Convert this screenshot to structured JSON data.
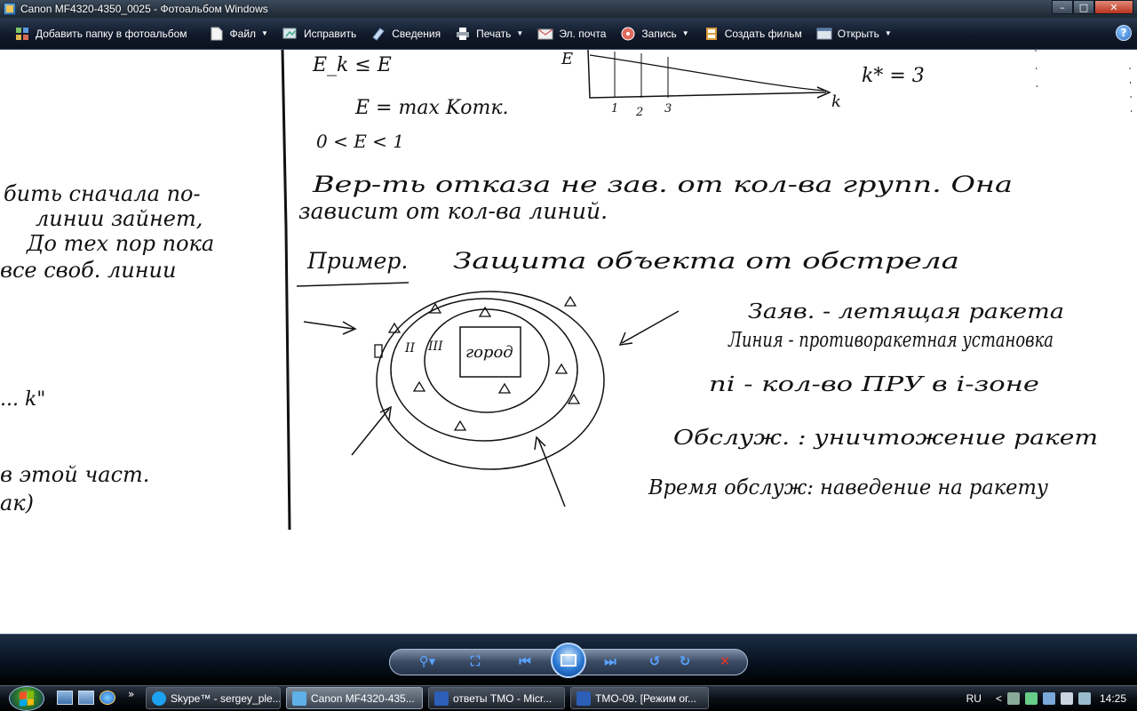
{
  "window": {
    "title": "Canon MF4320-4350_0025 - Фотоальбом Windows",
    "controls": {
      "minimize": "–",
      "maximize": "□",
      "close": "✕"
    }
  },
  "toolbar": {
    "items": [
      {
        "label": "Добавить папку в фотоальбом",
        "icon": "add-folder-icon",
        "dropdown": false
      },
      {
        "label": "Файл",
        "icon": "file-icon",
        "dropdown": true
      },
      {
        "label": "Исправить",
        "icon": "fix-icon",
        "dropdown": false
      },
      {
        "label": "Сведения",
        "icon": "info-icon",
        "dropdown": false
      },
      {
        "label": "Печать",
        "icon": "printer-icon",
        "dropdown": true
      },
      {
        "label": "Эл. почта",
        "icon": "email-icon",
        "dropdown": false
      },
      {
        "label": "Запись",
        "icon": "burn-disc-icon",
        "dropdown": true
      },
      {
        "label": "Создать фильм",
        "icon": "film-icon",
        "dropdown": false
      },
      {
        "label": "Открыть",
        "icon": "open-icon",
        "dropdown": true
      }
    ],
    "help": "?"
  },
  "photo": {
    "left_page": [
      "бить сначала по-",
      "линии зайнет,",
      "До тех пор пока",
      "все своб. линии",
      "... k\"",
      "в этой част.",
      "ак)"
    ],
    "formulas": [
      "E_k ≤ E",
      "E = max Kотк.",
      "0 < E < 1",
      "k* = 3"
    ],
    "axis_label": "k",
    "axis_ticks": [
      "1",
      "2",
      "3"
    ],
    "text_lines": [
      "Вер-ть отказа не зав. от кол-ва групп. Она",
      "зависит от кол-ва линий."
    ],
    "heading_word": "Пример.",
    "heading": "Защита объекта от обстрела",
    "city_label": "город",
    "zone_labels": [
      "II",
      "III"
    ],
    "notes": [
      "Заяв. - летящая ракета",
      "Линия - противоракетная установка",
      "ni - кол-во ПРУ в i-зоне",
      "Обслуж. : уничтожение ракет",
      "Время обслуж: наведение на ракету"
    ]
  },
  "viewer_controls": {
    "zoom": "zoom-icon",
    "fit": "fit-icon",
    "previous": "previous-icon",
    "slideshow": "slideshow-icon",
    "next": "next-icon",
    "rotate_left": "rotate-left-icon",
    "rotate_right": "rotate-right-icon",
    "delete": "delete-icon"
  },
  "taskbar": {
    "tasks": [
      {
        "label": "Skype™ - sergey_ple...",
        "color": "#1da1f2",
        "active": false
      },
      {
        "label": "Canon MF4320-435...",
        "color": "#5fb0e8",
        "active": true
      },
      {
        "label": "ответы ТМО - Micr...",
        "color": "#2b5fb8",
        "active": false
      },
      {
        "label": "ТМО-09. [Режим ог...",
        "color": "#2b5fb8",
        "active": false
      }
    ],
    "quicklaunch_more": "»",
    "language": "RU",
    "tray_more": "<",
    "clock": "14:25"
  },
  "colors": {
    "accent": "#5aa2ff",
    "delete": "#e8352b",
    "ink": "#111111"
  }
}
